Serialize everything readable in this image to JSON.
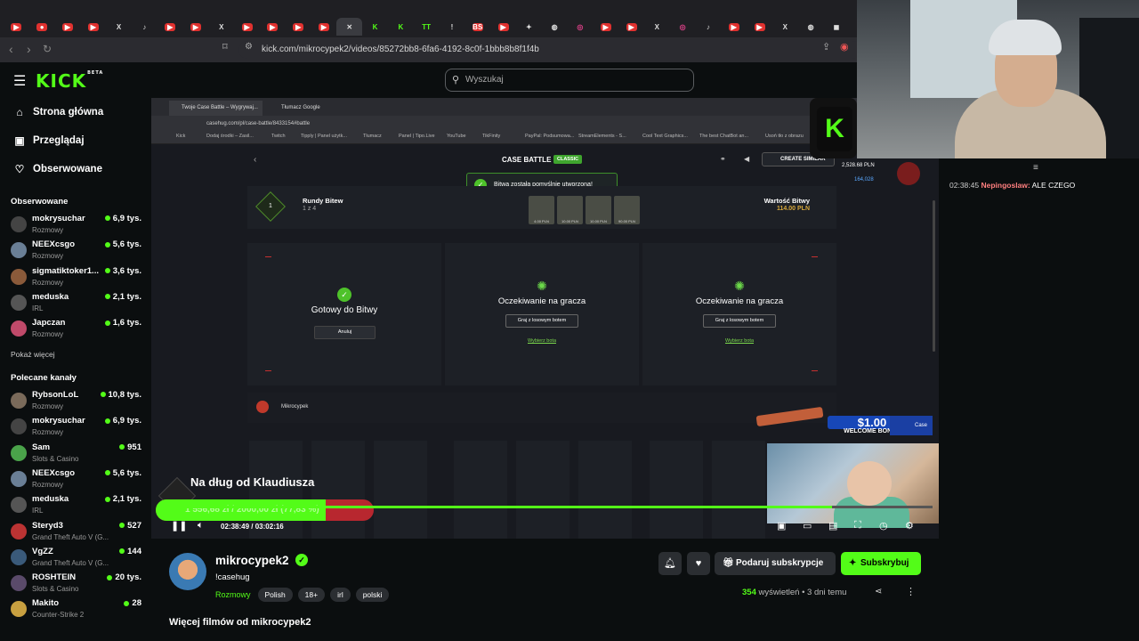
{
  "browser": {
    "url": "kick.com/mikrocypek2/videos/85272bb8-6fa6-4192-8c0f-1bbb8b8f1f4b",
    "tabs": [
      "▶",
      "●",
      "▶",
      "▶",
      "X",
      "♪",
      "▶",
      "▶",
      "X",
      "▶",
      "▶",
      "▶",
      "▶",
      "✕",
      "K",
      "K",
      "TT",
      "!",
      "BS",
      "▶",
      "✦",
      "◍",
      "◎",
      "▶",
      "▶",
      "X",
      "◎",
      "♪",
      "▶",
      "▶",
      "X",
      "◍",
      "◼",
      "◍"
    ]
  },
  "site": {
    "logo": "KICK",
    "logo_sup": "BETA",
    "search_placeholder": "Wyszukaj"
  },
  "sidebar": {
    "menu": [
      {
        "label": "Strona główna",
        "icon": "⌂"
      },
      {
        "label": "Przeglądaj",
        "icon": "▣"
      },
      {
        "label": "Obserwowane",
        "icon": "♡"
      }
    ],
    "followed_header": "Obserwowane",
    "followed": [
      {
        "name": "mokrysuchar",
        "category": "Rozmowy",
        "viewers": "6,9 tys.",
        "color": "#444"
      },
      {
        "name": "NEEXcsgo",
        "category": "Rozmowy",
        "viewers": "5,6 tys.",
        "color": "#6a7f96"
      },
      {
        "name": "sigmatiktoker1...",
        "category": "Rozmowy",
        "viewers": "3,6 tys.",
        "color": "#8a5a3a"
      },
      {
        "name": "meduska",
        "category": "IRL",
        "viewers": "2,1 tys.",
        "color": "#555"
      },
      {
        "name": "Japczan",
        "category": "Rozmowy",
        "viewers": "1,6 tys.",
        "color": "#c04a6a"
      }
    ],
    "show_more": "Pokaż więcej",
    "recommended_header": "Polecane kanały",
    "recommended": [
      {
        "name": "RybsonLoL",
        "category": "Rozmowy",
        "viewers": "10,8 tys.",
        "color": "#7a6a5a"
      },
      {
        "name": "mokrysuchar",
        "category": "Rozmowy",
        "viewers": "6,9 tys.",
        "color": "#444"
      },
      {
        "name": "Sam",
        "category": "Slots & Casino",
        "viewers": "951",
        "color": "#4aa34a"
      },
      {
        "name": "NEEXcsgo",
        "category": "Rozmowy",
        "viewers": "5,6 tys.",
        "color": "#6a7f96"
      },
      {
        "name": "meduska",
        "category": "IRL",
        "viewers": "2,1 tys.",
        "color": "#555"
      },
      {
        "name": "Steryd3",
        "category": "Grand Theft Auto V (G...",
        "viewers": "527",
        "color": "#b33"
      },
      {
        "name": "VgZZ",
        "category": "Grand Theft Auto V (G...",
        "viewers": "144",
        "color": "#3a5a7a"
      },
      {
        "name": "ROSHTEIN",
        "category": "Slots & Casino",
        "viewers": "20 tys.",
        "color": "#5a4a6a"
      },
      {
        "name": "Makito",
        "category": "Counter-Strike 2",
        "viewers": "28",
        "color": "#c8a040"
      }
    ]
  },
  "video": {
    "inner_tabs": [
      "Twoje Case Battle – Wygrywaj...",
      "Tłumacz Google"
    ],
    "inner_url": "casehug.com/pl/case-battle/8433154#battle",
    "bookmarks": [
      "Kick",
      "Dodaj środki – Zasil...",
      "Twitch",
      "Tipply | Panel użytk...",
      "Tłumacz",
      "Panel | Tipo.Live",
      "YouTube",
      "TikFinity",
      "PayPal: Podsumowa...",
      "StreamElements - S...",
      "Cool Text Graphics...",
      "The best ChatBot an...",
      "Usoń tło z obrazu"
    ],
    "cb_title": "CASE BATTLE",
    "cb_badge": "CLASSIC",
    "create_similar": "CREATE SIMILAR",
    "balance1": "2,528.68 PLN",
    "balance2": "164,028",
    "toast": "Bitwa została pomyślnie utworzona!",
    "round_num": "1",
    "rounds_label": "Rundy Bitew",
    "rounds_value": "1 z 4",
    "value_label": "Wartość Bitwy",
    "value_amount": "114.00 PLN",
    "case_prices": [
      "4.00 PLN",
      "10.00 PLN",
      "10.00 PLN",
      "90.00 PLN"
    ],
    "ready_text": "Gotowy do Bitwy",
    "cancel_text": "Anuluj",
    "waiting_text": "Oczekiwanie na gracza",
    "bot_btn": "Graj z losowym botem",
    "pick_bot": "Wybierz bota",
    "player_name": "Mikrocypek",
    "bonus_amount": "$1.00",
    "bonus_label": "WELCOME BONUS",
    "bonus_brand": "Case",
    "goal_title": "Na dług od Klaudiusza",
    "goal_text": "1 556,68 zł / 2000,00 zł (77,83 %)",
    "goal_fraction": 0.7783,
    "time_current": "02:38:49",
    "time_sep": "/",
    "time_total": "03:02:16",
    "progress_fraction": 0.8699
  },
  "chat": {
    "time": "02:38:45",
    "user": "Nepingoslaw:",
    "message": "ALE CZEGO"
  },
  "channel": {
    "name": "mikrocypek2",
    "verified": "✓",
    "title": "!casehug",
    "category": "Rozmowy",
    "tags": [
      "Polish",
      "18+",
      "irl",
      "polski"
    ],
    "views_count": "354",
    "views_label": "wyświetleń",
    "dot": "•",
    "age": "3 dni temu",
    "gift_label": "Podaruj subskrypcje",
    "subscribe_label": "Subskrybuj",
    "more_videos": "Więcej filmów od mikrocypek2"
  }
}
